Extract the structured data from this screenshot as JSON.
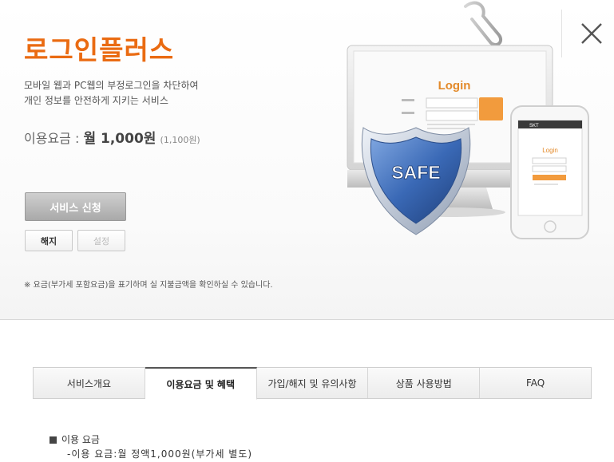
{
  "header": {
    "title": "로그인플러스",
    "description_line1": "모바일 웹과 PC웹의 부정로그인을  차단하여",
    "description_line2": "개인 정보를 안전하게 지키는  서비스",
    "price_label": "이용요금 : ",
    "price_amount": "월 1,000원",
    "price_vat": "(1,100원)"
  },
  "buttons": {
    "apply": "서비스 신청",
    "cancel": "해지",
    "settings": "설정"
  },
  "notice": "※ 요금(부가세 포함요금)을 표기하며 실 지불금액을 확인하실 수 있습니다.",
  "illustration": {
    "monitor_login_title": "Login",
    "shield_text": "SAFE",
    "phone_carrier": "SKT",
    "phone_login_title": "Login"
  },
  "tabs": [
    {
      "label": "서비스개요",
      "active": false
    },
    {
      "label": "이용요금 및 혜택",
      "active": true
    },
    {
      "label": "가입/해지 및 유의사항",
      "active": false
    },
    {
      "label": "상품 사용방법",
      "active": false
    },
    {
      "label": "FAQ",
      "active": false
    }
  ],
  "content": {
    "section_title": "이용 요금",
    "item1": "-이용 요금:월 정액1,000원(부가세 별도)"
  },
  "colors": {
    "accent": "#ea6b12",
    "shield_blue": "#3a69b6"
  }
}
